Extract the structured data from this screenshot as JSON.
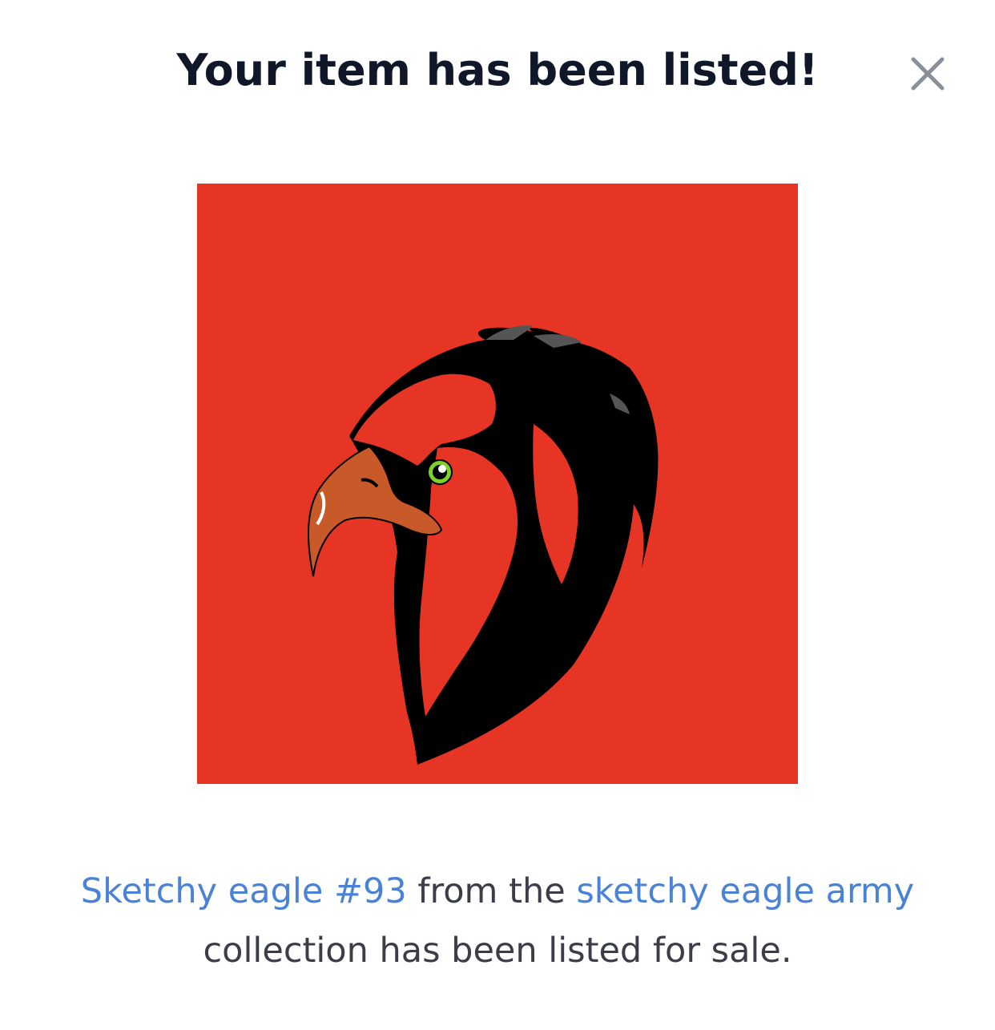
{
  "modal": {
    "title": "Your item has been listed!",
    "close_icon": "close-icon",
    "image": {
      "subject": "eagle-head-illustration",
      "background_color": "#e63525"
    },
    "message": {
      "item_link": "Sketchy eagle #93",
      "text_1": " from the ",
      "collection_link": "sketchy eagle army",
      "text_2": " collection has been listed for sale."
    }
  },
  "colors": {
    "title": "#0f1729",
    "link": "#4a82d6",
    "body_text": "#3b3d48",
    "close_icon": "#8a909a"
  }
}
